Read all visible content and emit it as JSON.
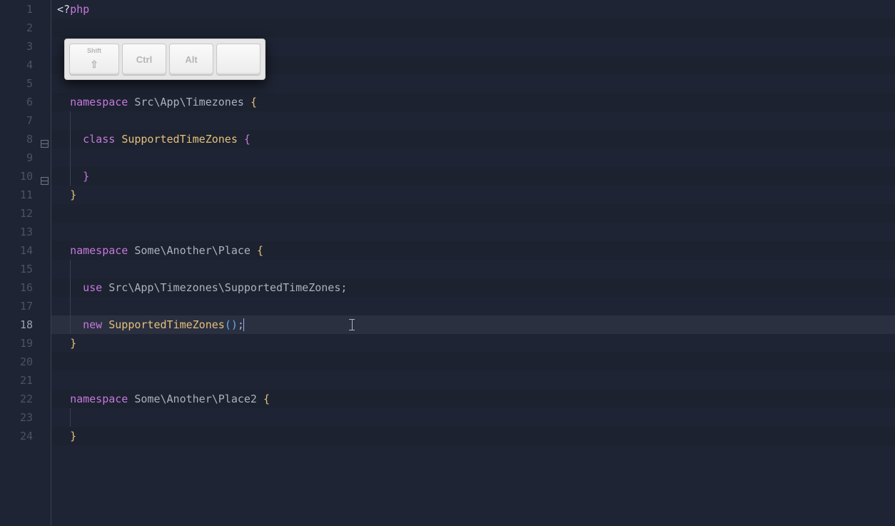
{
  "keycaps": {
    "shift": "Shift",
    "ctrl": "Ctrl",
    "alt": "Alt"
  },
  "lines": [
    {
      "num": 1
    },
    {
      "num": 2
    },
    {
      "num": 3
    },
    {
      "num": 4
    },
    {
      "num": 5
    },
    {
      "num": 6
    },
    {
      "num": 7
    },
    {
      "num": 8
    },
    {
      "num": 9
    },
    {
      "num": 10
    },
    {
      "num": 11
    },
    {
      "num": 12
    },
    {
      "num": 13
    },
    {
      "num": 14
    },
    {
      "num": 15
    },
    {
      "num": 16
    },
    {
      "num": 17
    },
    {
      "num": 18
    },
    {
      "num": 19
    },
    {
      "num": 20
    },
    {
      "num": 21
    },
    {
      "num": 22
    },
    {
      "num": 23
    },
    {
      "num": 24
    }
  ],
  "code": {
    "php_open": "<?",
    "php_word": "php",
    "kw_namespace": "namespace",
    "kw_class": "class",
    "kw_use": "use",
    "kw_new": "new",
    "ns1": "Src\\App\\Timezones",
    "class1": "SupportedTimeZones",
    "ns2": "Some\\Another\\Place",
    "use_ns": "Src\\App\\Timezones\\SupportedTimeZones",
    "new_class": "SupportedTimeZones",
    "ns3": "Some\\Another\\Place2",
    "brace_open": "{",
    "brace_close": "}",
    "paren_open": "(",
    "paren_close": ")",
    "semicolon": ";"
  },
  "active_line": 18
}
